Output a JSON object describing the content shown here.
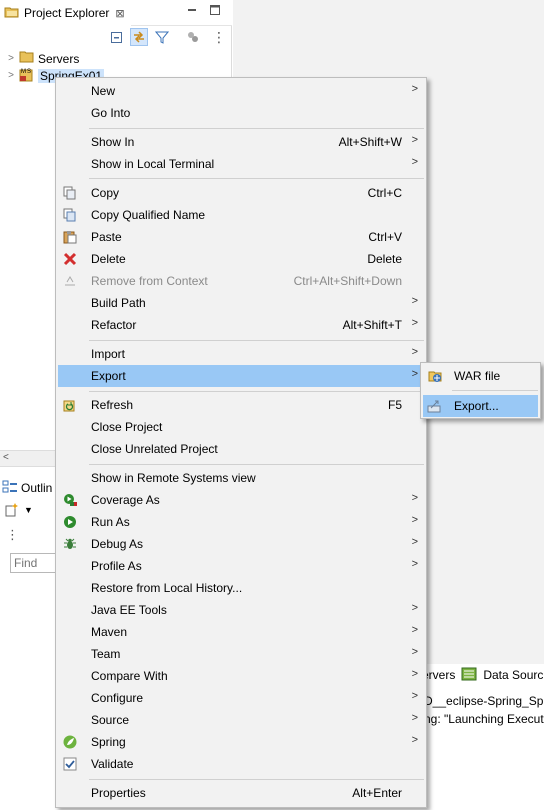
{
  "project_explorer": {
    "tab_label": "Project Explorer",
    "close_glyph": "⊠",
    "minimize_glyph": "▭",
    "maximize_glyph": "◻",
    "view_menu_glyph": "⋮",
    "tree": [
      {
        "label": "Servers",
        "icon": "folder-icon"
      },
      {
        "label": "SpringEx01",
        "icon": "project-icon",
        "selected": true
      }
    ]
  },
  "outline": {
    "tab_label": "Outlin",
    "find_placeholder": "Find",
    "menu_glyph": "⋮"
  },
  "console": {
    "tabs": [
      {
        "label": "ervers"
      },
      {
        "label": "Data Sourc"
      }
    ],
    "lines": [
      "D__eclipse-Spring_Sprin",
      "ng: \"Launching Execut"
    ]
  },
  "context_menu": {
    "items": [
      {
        "type": "item",
        "label": "New",
        "accel": "",
        "submenu": true,
        "icon": ""
      },
      {
        "type": "item",
        "label": "Go Into",
        "accel": "",
        "submenu": false,
        "icon": ""
      },
      {
        "type": "sep"
      },
      {
        "type": "item",
        "label": "Show In",
        "accel": "Alt+Shift+W",
        "submenu": true,
        "icon": ""
      },
      {
        "type": "item",
        "label": "Show in Local Terminal",
        "accel": "",
        "submenu": true,
        "icon": ""
      },
      {
        "type": "sep"
      },
      {
        "type": "item",
        "label": "Copy",
        "accel": "Ctrl+C",
        "submenu": false,
        "icon": "copy-icon"
      },
      {
        "type": "item",
        "label": "Copy Qualified Name",
        "accel": "",
        "submenu": false,
        "icon": "copy-qualified-icon"
      },
      {
        "type": "item",
        "label": "Paste",
        "accel": "Ctrl+V",
        "submenu": false,
        "icon": "paste-icon"
      },
      {
        "type": "item",
        "label": "Delete",
        "accel": "Delete",
        "submenu": false,
        "icon": "delete-icon"
      },
      {
        "type": "item",
        "label": "Remove from Context",
        "accel": "Ctrl+Alt+Shift+Down",
        "submenu": false,
        "icon": "remove-context-icon",
        "disabled": true
      },
      {
        "type": "item",
        "label": "Build Path",
        "accel": "",
        "submenu": true,
        "icon": ""
      },
      {
        "type": "item",
        "label": "Refactor",
        "accel": "Alt+Shift+T",
        "submenu": true,
        "icon": ""
      },
      {
        "type": "sep"
      },
      {
        "type": "item",
        "label": "Import",
        "accel": "",
        "submenu": true,
        "icon": ""
      },
      {
        "type": "item",
        "label": "Export",
        "accel": "",
        "submenu": true,
        "icon": "",
        "highlighted": true
      },
      {
        "type": "sep"
      },
      {
        "type": "item",
        "label": "Refresh",
        "accel": "F5",
        "submenu": false,
        "icon": "refresh-icon"
      },
      {
        "type": "item",
        "label": "Close Project",
        "accel": "",
        "submenu": false,
        "icon": ""
      },
      {
        "type": "item",
        "label": "Close Unrelated Project",
        "accel": "",
        "submenu": false,
        "icon": ""
      },
      {
        "type": "sep"
      },
      {
        "type": "item",
        "label": "Show in Remote Systems view",
        "accel": "",
        "submenu": false,
        "icon": ""
      },
      {
        "type": "item",
        "label": "Coverage As",
        "accel": "",
        "submenu": true,
        "icon": "coverage-icon"
      },
      {
        "type": "item",
        "label": "Run As",
        "accel": "",
        "submenu": true,
        "icon": "run-icon"
      },
      {
        "type": "item",
        "label": "Debug As",
        "accel": "",
        "submenu": true,
        "icon": "debug-icon"
      },
      {
        "type": "item",
        "label": "Profile As",
        "accel": "",
        "submenu": true,
        "icon": ""
      },
      {
        "type": "item",
        "label": "Restore from Local History...",
        "accel": "",
        "submenu": false,
        "icon": ""
      },
      {
        "type": "item",
        "label": "Java EE Tools",
        "accel": "",
        "submenu": true,
        "icon": ""
      },
      {
        "type": "item",
        "label": "Maven",
        "accel": "",
        "submenu": true,
        "icon": ""
      },
      {
        "type": "item",
        "label": "Team",
        "accel": "",
        "submenu": true,
        "icon": ""
      },
      {
        "type": "item",
        "label": "Compare With",
        "accel": "",
        "submenu": true,
        "icon": ""
      },
      {
        "type": "item",
        "label": "Configure",
        "accel": "",
        "submenu": true,
        "icon": ""
      },
      {
        "type": "item",
        "label": "Source",
        "accel": "",
        "submenu": true,
        "icon": ""
      },
      {
        "type": "item",
        "label": "Spring",
        "accel": "",
        "submenu": true,
        "icon": "spring-icon"
      },
      {
        "type": "item",
        "label": "Validate",
        "accel": "",
        "submenu": false,
        "icon": "validate-icon"
      },
      {
        "type": "sep"
      },
      {
        "type": "item",
        "label": "Properties",
        "accel": "Alt+Enter",
        "submenu": false,
        "icon": ""
      }
    ]
  },
  "export_submenu": {
    "items": [
      {
        "label": "WAR file",
        "icon": "war-file-icon"
      },
      {
        "label": "Export...",
        "icon": "export-icon",
        "highlighted": true
      }
    ]
  },
  "colors": {
    "menu_bg": "#f2f2f2",
    "highlight": "#99c8f5",
    "separator": "#d0d0d0",
    "disabled_text": "#8a8a8a"
  }
}
